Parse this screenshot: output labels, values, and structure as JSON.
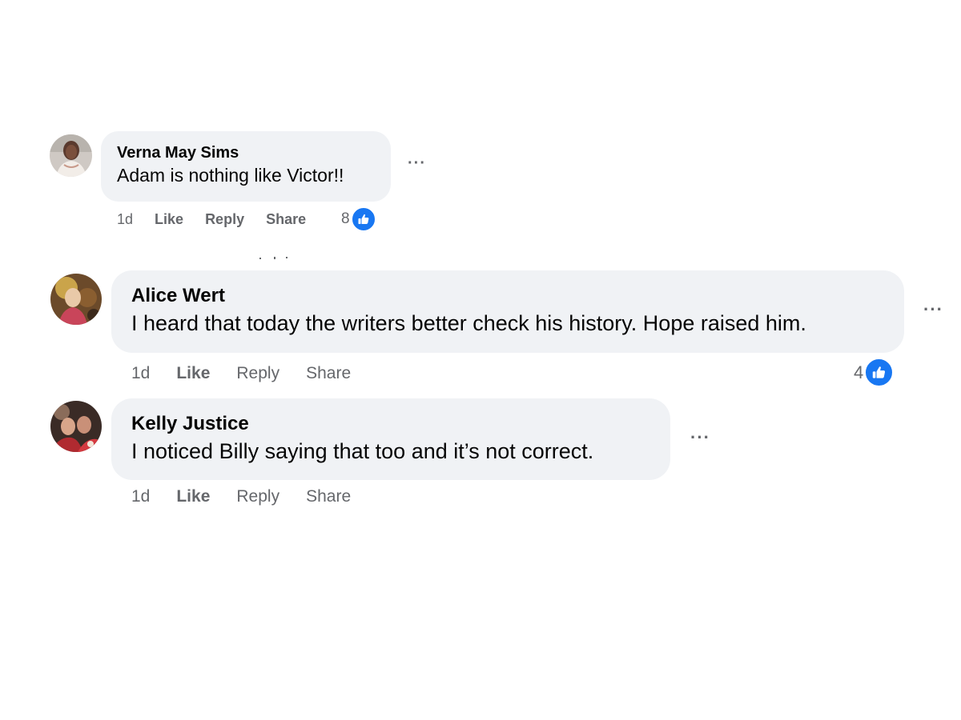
{
  "comments": [
    {
      "author": "Verna May Sims",
      "text": "Adam is nothing like Victor!!",
      "time": "1d",
      "like_label": "Like",
      "reply_label": "Reply",
      "share_label": "Share",
      "reaction_count": "8",
      "more_label": "···"
    },
    {
      "author": "Alice Wert",
      "text": "I heard that today the writers better check his history. Hope raised him.",
      "time": "1d",
      "like_label": "Like",
      "reply_label": "Reply",
      "share_label": "Share",
      "reaction_count": "4",
      "more_label": "···"
    },
    {
      "author": "Kelly Justice",
      "text": "I noticed Billy saying that too and it’s not correct.",
      "time": "1d",
      "like_label": "Like",
      "reply_label": "Reply",
      "share_label": "Share",
      "more_label": "···"
    }
  ],
  "icons": {
    "reaction": "thumbs-up-icon",
    "more": "more-options-icon"
  },
  "colors": {
    "bubble": "#f0f2f5",
    "meta_text": "#65676b",
    "like_blue": "#1877f2"
  }
}
